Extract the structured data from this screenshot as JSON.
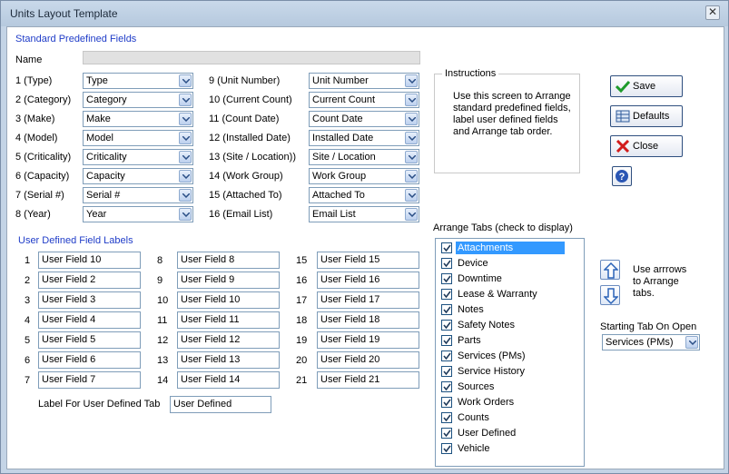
{
  "window": {
    "title": "Units Layout Template",
    "close_glyph": "✕"
  },
  "standard": {
    "heading": "Standard Predefined Fields",
    "name_label": "Name",
    "left": [
      {
        "label": "1 (Type)",
        "value": "Type"
      },
      {
        "label": "2 (Category)",
        "value": "Category"
      },
      {
        "label": "3 (Make)",
        "value": "Make"
      },
      {
        "label": "4 (Model)",
        "value": "Model"
      },
      {
        "label": "5 (Criticality)",
        "value": "Criticality"
      },
      {
        "label": "6 (Capacity)",
        "value": "Capacity"
      },
      {
        "label": "7 (Serial #)",
        "value": "Serial #"
      },
      {
        "label": "8 (Year)",
        "value": "Year"
      }
    ],
    "right": [
      {
        "label": "9 (Unit Number)",
        "value": "Unit Number"
      },
      {
        "label": "10 (Current Count)",
        "value": "Current Count"
      },
      {
        "label": "11 (Count Date)",
        "value": "Count Date"
      },
      {
        "label": "12 (Installed Date)",
        "value": "Installed Date"
      },
      {
        "label": "13 (Site / Location))",
        "value": "Site / Location"
      },
      {
        "label": "14 (Work Group)",
        "value": "Work Group"
      },
      {
        "label": "15 (Attached To)",
        "value": "Attached To"
      },
      {
        "label": "16 (Email List)",
        "value": "Email List"
      }
    ]
  },
  "instructions": {
    "title": "Instructions",
    "text": "Use this screen to Arrange standard predefined fields, label user defined fields and Arrange tab order."
  },
  "buttons": {
    "save": "Save",
    "defaults": "Defaults",
    "close": "Close",
    "help_glyph": "?"
  },
  "user_defined": {
    "heading": "User Defined Field Labels",
    "col1": [
      {
        "num": "1",
        "value": "User Field 10"
      },
      {
        "num": "2",
        "value": "User Field 2"
      },
      {
        "num": "3",
        "value": "User Field 3"
      },
      {
        "num": "4",
        "value": "User Field 4"
      },
      {
        "num": "5",
        "value": "User Field 5"
      },
      {
        "num": "6",
        "value": "User Field 6"
      },
      {
        "num": "7",
        "value": "User Field 7"
      }
    ],
    "col2": [
      {
        "num": "8",
        "value": "User Field 8"
      },
      {
        "num": "9",
        "value": "User Field 9"
      },
      {
        "num": "10",
        "value": "User Field 10"
      },
      {
        "num": "11",
        "value": "User Field 11"
      },
      {
        "num": "12",
        "value": "User Field 12"
      },
      {
        "num": "13",
        "value": "User Field 13"
      },
      {
        "num": "14",
        "value": "User Field 14"
      }
    ],
    "col3": [
      {
        "num": "15",
        "value": "User Field 15"
      },
      {
        "num": "16",
        "value": "User Field 16"
      },
      {
        "num": "17",
        "value": "User Field 17"
      },
      {
        "num": "18",
        "value": "User Field 18"
      },
      {
        "num": "19",
        "value": "User Field 19"
      },
      {
        "num": "20",
        "value": "User Field 20"
      },
      {
        "num": "21",
        "value": "User Field 21"
      }
    ],
    "tab_label_caption": "Label For User Defined Tab",
    "tab_label_value": "User Defined"
  },
  "arrange": {
    "heading": "Arrange Tabs (check to display)",
    "items": [
      {
        "label": "Attachments",
        "selected": true
      },
      {
        "label": "Device"
      },
      {
        "label": "Downtime"
      },
      {
        "label": "Lease & Warranty"
      },
      {
        "label": "Notes"
      },
      {
        "label": "Safety Notes"
      },
      {
        "label": "Parts"
      },
      {
        "label": "Services (PMs)"
      },
      {
        "label": "Service History"
      },
      {
        "label": "Sources"
      },
      {
        "label": "Work Orders"
      },
      {
        "label": "Counts"
      },
      {
        "label": "User Defined"
      },
      {
        "label": "Vehicle"
      }
    ],
    "hint": "Use arrrows to Arrange tabs.",
    "starting_label": "Starting Tab On Open",
    "starting_value": "Services (PMs)"
  }
}
